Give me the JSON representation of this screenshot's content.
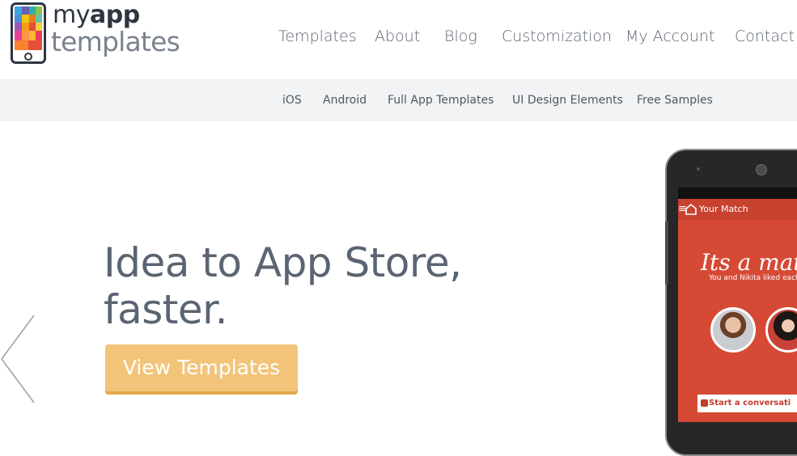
{
  "brand": {
    "name_my": "my",
    "name_app": "app",
    "name_templates": "templates",
    "icon": "phone-mosaic-logo-icon"
  },
  "main_nav": {
    "items": [
      {
        "label": "Templates"
      },
      {
        "label": "About"
      },
      {
        "label": "Blog"
      },
      {
        "label": "Customization"
      },
      {
        "label": "My Account"
      },
      {
        "label": "Contact"
      }
    ]
  },
  "sub_nav": {
    "items": [
      {
        "label": "iOS"
      },
      {
        "label": "Android"
      },
      {
        "label": "Full App Templates"
      },
      {
        "label": "UI Design Elements"
      },
      {
        "label": "Free Samples"
      }
    ]
  },
  "hero": {
    "title_line1": "Idea to App Store,",
    "title_line2": "faster.",
    "cta_label": "View Templates",
    "prev_icon": "chevron-left-icon"
  },
  "device_preview": {
    "app_bar_menu": "≡",
    "app_bar_title": "Your Match",
    "match_title": "Its a match",
    "match_subtitle": "You and Nikita liked each",
    "start_button": "Start a conversati"
  },
  "colors": {
    "cta": "#f2c47a",
    "subnav_bg": "#f1f3f4",
    "text": "#5d6470",
    "app_red": "#d64a35"
  }
}
